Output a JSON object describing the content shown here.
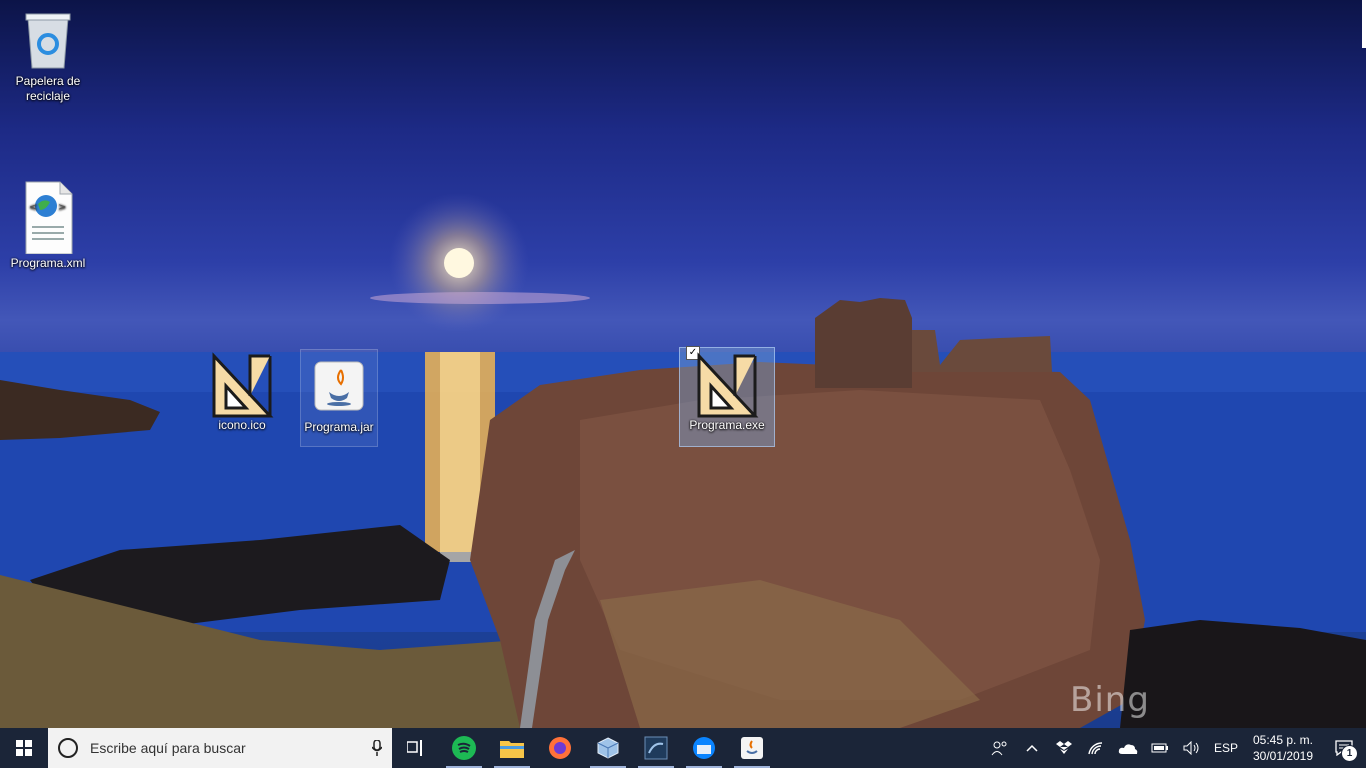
{
  "desktop": {
    "icons": [
      {
        "label": "Papelera de reciclaje",
        "icon": "recycle-bin-icon"
      },
      {
        "label": "Programa.xml",
        "icon": "xml-file-icon"
      },
      {
        "label": "icono.ico",
        "icon": "set-square-icon"
      },
      {
        "label": "Programa.jar",
        "icon": "java-file-icon"
      },
      {
        "label": "Programa.exe",
        "icon": "set-square-icon"
      }
    ],
    "watermark": "Bing"
  },
  "taskbar": {
    "search_placeholder": "Escribe aquí para buscar",
    "apps": [
      "task-view",
      "spotify",
      "file-explorer",
      "firefox",
      "virtualbox",
      "mysql-workbench",
      "thunderbird",
      "java"
    ],
    "tray": {
      "language": "ESP",
      "time": "05:45 p. m.",
      "date": "30/01/2019",
      "notification_count": "1"
    }
  },
  "colors": {
    "taskbar": "#1b2538",
    "selection": "#78a0d2"
  }
}
